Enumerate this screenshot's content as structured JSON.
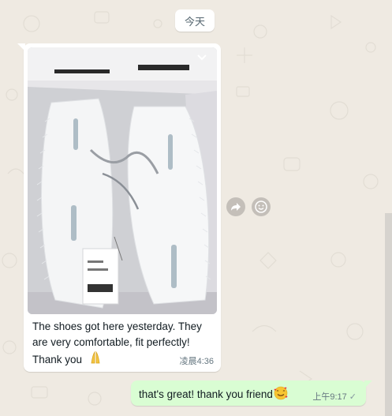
{
  "chat": {
    "date_divider": "今天",
    "messages": [
      {
        "direction": "incoming",
        "type": "image-with-caption",
        "image_description": "Photo of white knit sneakers lying in an open white shoebox with a price tag",
        "caption": "The shoes got here yesterday. They are very comfortable, fit perfectly! Thank you",
        "caption_emoji": "folded-hands",
        "time": "凌晨4:36"
      },
      {
        "direction": "outgoing",
        "type": "text",
        "text": "that's great! thank you friend",
        "text_emoji": "smiling-face-with-hearts",
        "time": "上午9:17",
        "status": "sent-single-check"
      }
    ],
    "hover_actions": [
      "forward-icon",
      "emoji-reaction-icon"
    ]
  },
  "colors": {
    "wallpaper": "#efeae2",
    "incoming_bubble": "#ffffff",
    "outgoing_bubble": "#d9fdd3",
    "meta_text": "#667781"
  }
}
